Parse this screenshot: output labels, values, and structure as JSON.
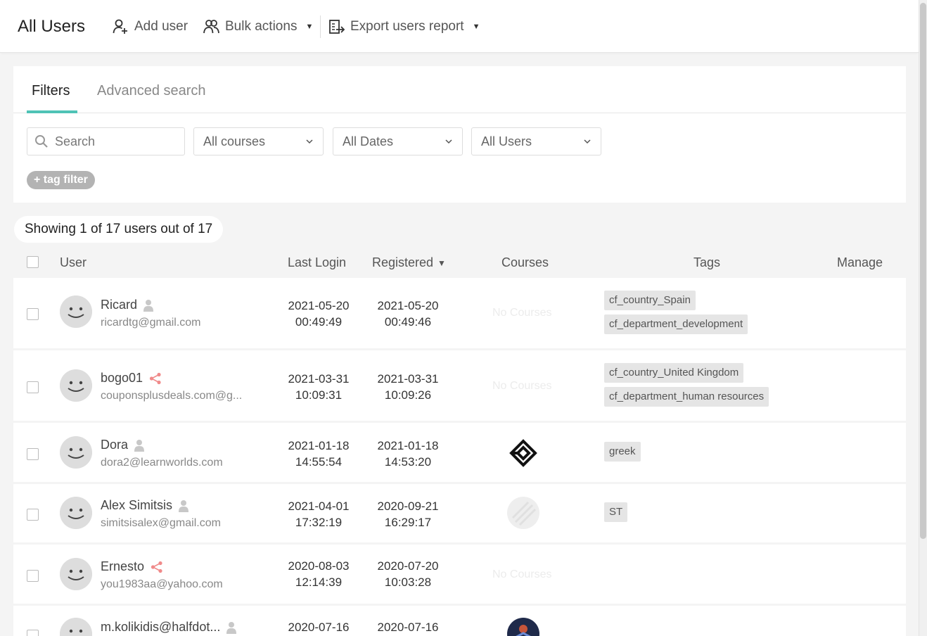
{
  "header": {
    "title": "All Users",
    "add_user": "Add user",
    "bulk_actions": "Bulk actions",
    "export_report": "Export users report"
  },
  "filters": {
    "tab_filters": "Filters",
    "tab_advanced": "Advanced search",
    "search_placeholder": "Search",
    "courses": "All courses",
    "dates": "All Dates",
    "users": "All Users",
    "tag_filter": "+ tag filter"
  },
  "showing": "Showing 1 of 17 users out of 17",
  "table": {
    "col_user": "User",
    "col_last_login": "Last Login",
    "col_registered": "Registered",
    "col_courses": "Courses",
    "col_tags": "Tags",
    "col_manage": "Manage",
    "rows": [
      {
        "name": "Ricard",
        "email": "ricardtg@gmail.com",
        "last_login_date": "2021-05-20",
        "last_login_time": "00:49:49",
        "registered_date": "2021-05-20",
        "registered_time": "00:49:46",
        "courses": "No Courses",
        "tags": [
          "cf_country_Spain",
          "cf_department_development"
        ]
      },
      {
        "name": "bogo01",
        "email": "couponsplusdeals.com@g...",
        "last_login_date": "2021-03-31",
        "last_login_time": "10:09:31",
        "registered_date": "2021-03-31",
        "registered_time": "10:09:26",
        "courses": "No Courses",
        "tags": [
          "cf_country_United Kingdom",
          "cf_department_human resources"
        ]
      },
      {
        "name": "Dora",
        "email": "dora2@learnworlds.com",
        "last_login_date": "2021-01-18",
        "last_login_time": "14:55:54",
        "registered_date": "2021-01-18",
        "registered_time": "14:53:20",
        "courses": "",
        "tags": [
          "greek"
        ]
      },
      {
        "name": "Alex Simitsis",
        "email": "simitsisalex@gmail.com",
        "last_login_date": "2021-04-01",
        "last_login_time": "17:32:19",
        "registered_date": "2020-09-21",
        "registered_time": "16:29:17",
        "courses": "",
        "tags": [
          "ST"
        ]
      },
      {
        "name": "Ernesto",
        "email": "you1983aa@yahoo.com",
        "last_login_date": "2020-08-03",
        "last_login_time": "12:14:39",
        "registered_date": "2020-07-20",
        "registered_time": "10:03:28",
        "courses": "No Courses",
        "tags": []
      },
      {
        "name": "m.kolikidis@halfdot...",
        "email": "",
        "last_login_date": "2020-07-16",
        "last_login_time": "",
        "registered_date": "2020-07-16",
        "registered_time": "",
        "courses": "",
        "tags": []
      }
    ]
  }
}
